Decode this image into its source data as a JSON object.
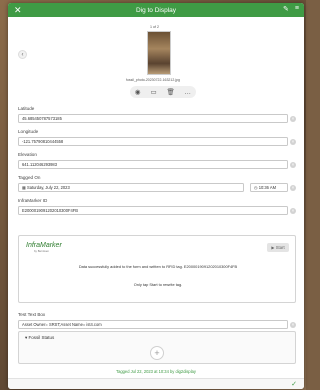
{
  "window": {
    "title": "Dig to Display",
    "close_icon": "close-icon",
    "right_icons": [
      "brush-icon",
      "menu-icon"
    ]
  },
  "media": {
    "counter": "1 of 2",
    "filename": "fossil_photo-20230722-163212.jpg",
    "actions": [
      "camera-icon",
      "folder-icon",
      "trash-icon",
      "more-icon"
    ]
  },
  "fields": {
    "latitude": {
      "label": "Latitude",
      "value": "45.685450787573185"
    },
    "longitude": {
      "label": "Longitude",
      "value": "-121.75790810444558"
    },
    "elevation": {
      "label": "Elevation",
      "value": "641.112046293983"
    },
    "tagged_on": {
      "label": "Tagged On",
      "date": "Saturday, July 22, 2023",
      "time": "10:36 AM"
    },
    "infamarker": {
      "label": "InfraMarker ID",
      "value": "E2000019091202010300F4FB"
    },
    "test_box": {
      "label": "Test Text Box",
      "value": "Asset Owner= SRST;Asset Name= ist4.com"
    }
  },
  "rfid": {
    "logo": "InfraMarker",
    "logo_sub": "by Berntsen",
    "start_label": "Start",
    "message_line1": "Data successfully added to the form and written to RFID tag. E2000019091202010300F4FB",
    "message_line2": "Only tap Start to rewrite tag."
  },
  "group": {
    "title": "Fossil Status",
    "add_label": "+"
  },
  "footer": {
    "status": "Tagged Jul 22, 2023 at 10:34 by dig2display",
    "check": "✓"
  }
}
